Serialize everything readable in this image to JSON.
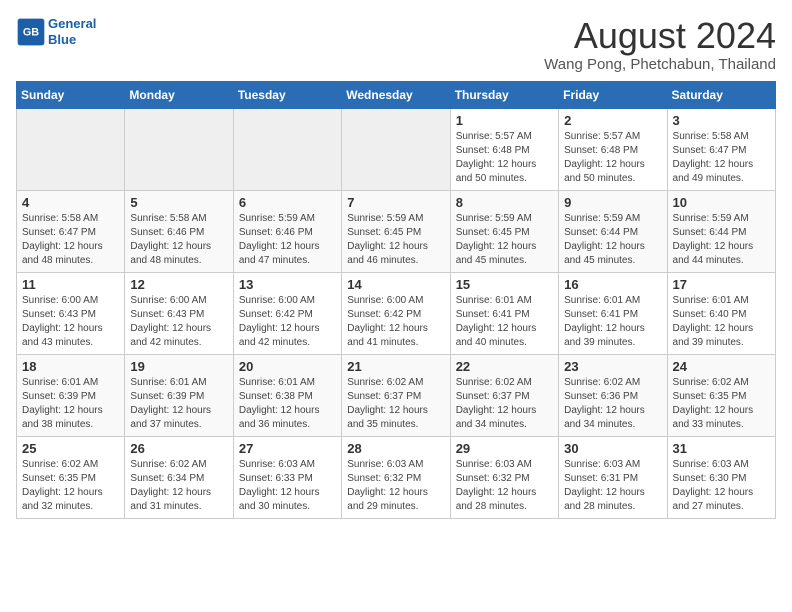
{
  "header": {
    "logo_line1": "General",
    "logo_line2": "Blue",
    "main_title": "August 2024",
    "subtitle": "Wang Pong, Phetchabun, Thailand"
  },
  "days_of_week": [
    "Sunday",
    "Monday",
    "Tuesday",
    "Wednesday",
    "Thursday",
    "Friday",
    "Saturday"
  ],
  "weeks": [
    [
      {
        "date": "",
        "info": ""
      },
      {
        "date": "",
        "info": ""
      },
      {
        "date": "",
        "info": ""
      },
      {
        "date": "",
        "info": ""
      },
      {
        "date": "1",
        "info": "Sunrise: 5:57 AM\nSunset: 6:48 PM\nDaylight: 12 hours\nand 50 minutes."
      },
      {
        "date": "2",
        "info": "Sunrise: 5:57 AM\nSunset: 6:48 PM\nDaylight: 12 hours\nand 50 minutes."
      },
      {
        "date": "3",
        "info": "Sunrise: 5:58 AM\nSunset: 6:47 PM\nDaylight: 12 hours\nand 49 minutes."
      }
    ],
    [
      {
        "date": "4",
        "info": "Sunrise: 5:58 AM\nSunset: 6:47 PM\nDaylight: 12 hours\nand 48 minutes."
      },
      {
        "date": "5",
        "info": "Sunrise: 5:58 AM\nSunset: 6:46 PM\nDaylight: 12 hours\nand 48 minutes."
      },
      {
        "date": "6",
        "info": "Sunrise: 5:59 AM\nSunset: 6:46 PM\nDaylight: 12 hours\nand 47 minutes."
      },
      {
        "date": "7",
        "info": "Sunrise: 5:59 AM\nSunset: 6:45 PM\nDaylight: 12 hours\nand 46 minutes."
      },
      {
        "date": "8",
        "info": "Sunrise: 5:59 AM\nSunset: 6:45 PM\nDaylight: 12 hours\nand 45 minutes."
      },
      {
        "date": "9",
        "info": "Sunrise: 5:59 AM\nSunset: 6:44 PM\nDaylight: 12 hours\nand 45 minutes."
      },
      {
        "date": "10",
        "info": "Sunrise: 5:59 AM\nSunset: 6:44 PM\nDaylight: 12 hours\nand 44 minutes."
      }
    ],
    [
      {
        "date": "11",
        "info": "Sunrise: 6:00 AM\nSunset: 6:43 PM\nDaylight: 12 hours\nand 43 minutes."
      },
      {
        "date": "12",
        "info": "Sunrise: 6:00 AM\nSunset: 6:43 PM\nDaylight: 12 hours\nand 42 minutes."
      },
      {
        "date": "13",
        "info": "Sunrise: 6:00 AM\nSunset: 6:42 PM\nDaylight: 12 hours\nand 42 minutes."
      },
      {
        "date": "14",
        "info": "Sunrise: 6:00 AM\nSunset: 6:42 PM\nDaylight: 12 hours\nand 41 minutes."
      },
      {
        "date": "15",
        "info": "Sunrise: 6:01 AM\nSunset: 6:41 PM\nDaylight: 12 hours\nand 40 minutes."
      },
      {
        "date": "16",
        "info": "Sunrise: 6:01 AM\nSunset: 6:41 PM\nDaylight: 12 hours\nand 39 minutes."
      },
      {
        "date": "17",
        "info": "Sunrise: 6:01 AM\nSunset: 6:40 PM\nDaylight: 12 hours\nand 39 minutes."
      }
    ],
    [
      {
        "date": "18",
        "info": "Sunrise: 6:01 AM\nSunset: 6:39 PM\nDaylight: 12 hours\nand 38 minutes."
      },
      {
        "date": "19",
        "info": "Sunrise: 6:01 AM\nSunset: 6:39 PM\nDaylight: 12 hours\nand 37 minutes."
      },
      {
        "date": "20",
        "info": "Sunrise: 6:01 AM\nSunset: 6:38 PM\nDaylight: 12 hours\nand 36 minutes."
      },
      {
        "date": "21",
        "info": "Sunrise: 6:02 AM\nSunset: 6:37 PM\nDaylight: 12 hours\nand 35 minutes."
      },
      {
        "date": "22",
        "info": "Sunrise: 6:02 AM\nSunset: 6:37 PM\nDaylight: 12 hours\nand 34 minutes."
      },
      {
        "date": "23",
        "info": "Sunrise: 6:02 AM\nSunset: 6:36 PM\nDaylight: 12 hours\nand 34 minutes."
      },
      {
        "date": "24",
        "info": "Sunrise: 6:02 AM\nSunset: 6:35 PM\nDaylight: 12 hours\nand 33 minutes."
      }
    ],
    [
      {
        "date": "25",
        "info": "Sunrise: 6:02 AM\nSunset: 6:35 PM\nDaylight: 12 hours\nand 32 minutes."
      },
      {
        "date": "26",
        "info": "Sunrise: 6:02 AM\nSunset: 6:34 PM\nDaylight: 12 hours\nand 31 minutes."
      },
      {
        "date": "27",
        "info": "Sunrise: 6:03 AM\nSunset: 6:33 PM\nDaylight: 12 hours\nand 30 minutes."
      },
      {
        "date": "28",
        "info": "Sunrise: 6:03 AM\nSunset: 6:32 PM\nDaylight: 12 hours\nand 29 minutes."
      },
      {
        "date": "29",
        "info": "Sunrise: 6:03 AM\nSunset: 6:32 PM\nDaylight: 12 hours\nand 28 minutes."
      },
      {
        "date": "30",
        "info": "Sunrise: 6:03 AM\nSunset: 6:31 PM\nDaylight: 12 hours\nand 28 minutes."
      },
      {
        "date": "31",
        "info": "Sunrise: 6:03 AM\nSunset: 6:30 PM\nDaylight: 12 hours\nand 27 minutes."
      }
    ]
  ]
}
